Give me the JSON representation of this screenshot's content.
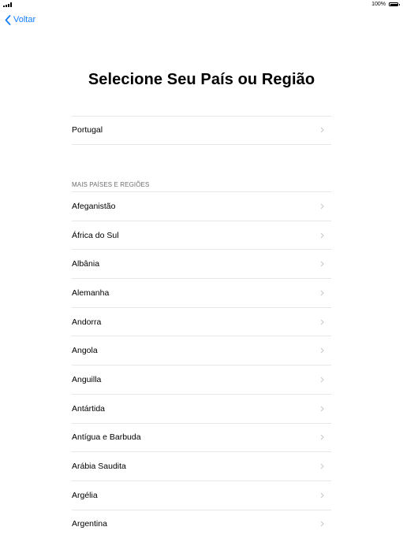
{
  "status": {
    "battery_percent": "100%"
  },
  "nav": {
    "back_label": "Voltar"
  },
  "page": {
    "title": "Selecione Seu País ou Região"
  },
  "current": {
    "label": "Portugal"
  },
  "more": {
    "header": "MAIS PAÍSES E REGIÕES",
    "items": [
      "Afeganistão",
      "África do Sul",
      "Albânia",
      "Alemanha",
      "Andorra",
      "Angola",
      "Anguilla",
      "Antártida",
      "Antígua e Barbuda",
      "Arábia Saudita",
      "Argélia",
      "Argentina"
    ]
  },
  "colors": {
    "accent": "#157efb",
    "separator": "#e6e6e6",
    "chevron": "#c7c7cc",
    "section_header": "#6d6d72"
  }
}
